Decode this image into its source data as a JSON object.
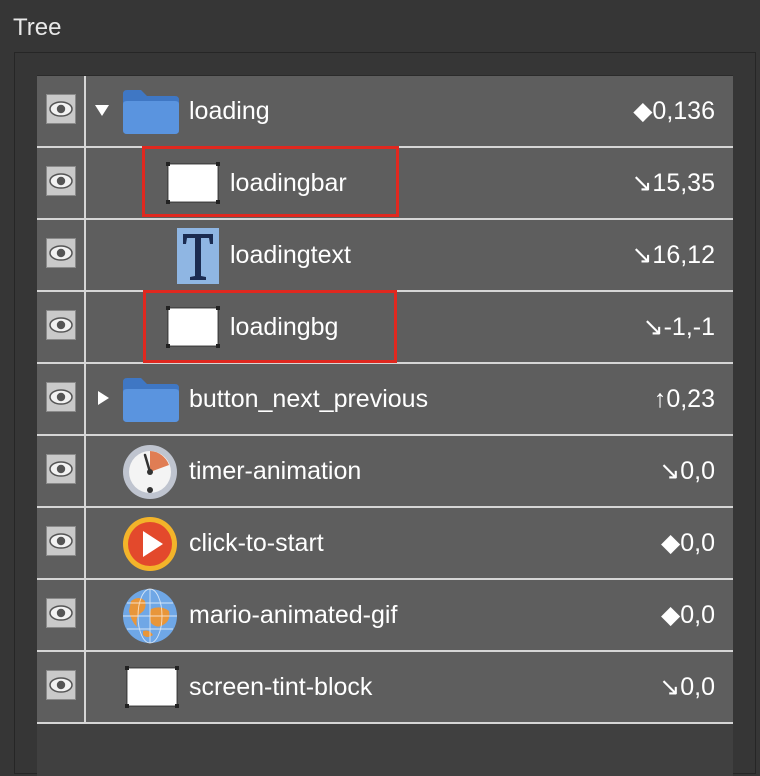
{
  "panel": {
    "title": "Tree"
  },
  "tree": {
    "items": [
      {
        "label": "loading",
        "coords": "◆0,136",
        "icon": "folder-icon",
        "expander": "expanded"
      },
      {
        "label": "loadingbar",
        "coords": "↘15,35",
        "icon": "white-rect-sprite-icon",
        "highlighted": true
      },
      {
        "label": "loadingtext",
        "coords": "↘16,12",
        "icon": "text-icon"
      },
      {
        "label": "loadingbg",
        "coords": "↘-1,-1",
        "icon": "white-rect-sprite-icon",
        "highlighted": true
      },
      {
        "label": "button_next_previous",
        "coords": "↑0,23",
        "icon": "folder-icon",
        "expander": "collapsed"
      },
      {
        "label": "timer-animation",
        "coords": "↘0,0",
        "icon": "timer-dial-icon"
      },
      {
        "label": "click-to-start",
        "coords": "◆0,0",
        "icon": "play-button-icon"
      },
      {
        "label": "mario-animated-gif",
        "coords": "◆0,0",
        "icon": "globe-icon"
      },
      {
        "label": "screen-tint-block",
        "coords": "↘0,0",
        "icon": "white-rect-sprite-icon"
      }
    ]
  },
  "colors": {
    "highlight": "#e0281f",
    "folder": "#4b84d0",
    "row_bg": "#5e5e5e",
    "separator": "#d6d6d6"
  }
}
